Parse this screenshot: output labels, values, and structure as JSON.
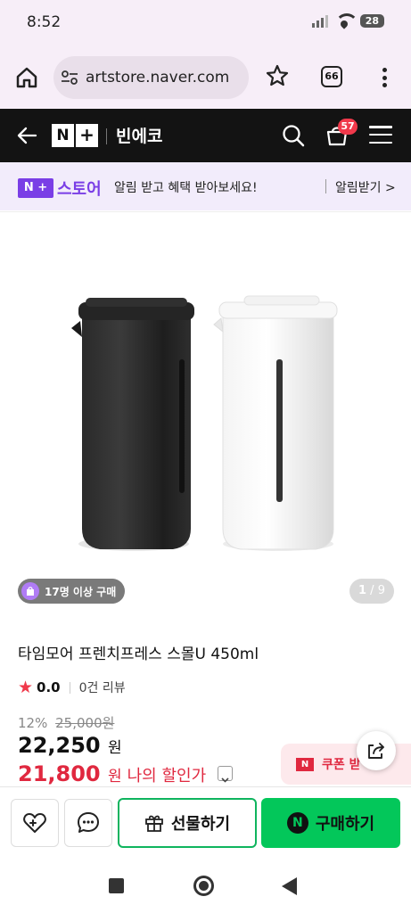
{
  "status_bar": {
    "time": "8:52",
    "battery": "28"
  },
  "browser": {
    "url": "artstore.naver.com",
    "tab_count": "66"
  },
  "store_header": {
    "logo_n": "N",
    "logo_plus": "+",
    "store_name": "빈에코",
    "cart_count": "57"
  },
  "notice": {
    "logo_box": "N +",
    "logo_text": "스토어",
    "message": "알림 받고 혜택 받아보세요!",
    "link": "알림받기 >"
  },
  "gallery": {
    "buyers_badge": "17명 이상 구매",
    "current_page": "1",
    "total_pages": "9"
  },
  "product": {
    "title": "타임모어 프렌치프레스 스몰U 450ml",
    "rating": "0.0",
    "reviews": "0건 리뷰",
    "discount_rate": "12%",
    "original_price": "25,000원",
    "sale_price": "22,250",
    "price_unit": "원",
    "my_price": "21,800",
    "my_price_label": "나의 할인가"
  },
  "coupon": {
    "badge": "N",
    "label": "쿠폰 받"
  },
  "actions": {
    "gift_label": "선물하기",
    "buy_label": "구매하기",
    "buy_icon_letter": "N"
  },
  "colors": {
    "naver_green": "#03c75a",
    "accent_purple": "#7a3ee6",
    "price_red": "#e0283f"
  },
  "icons": [
    "home-icon",
    "site-settings-icon",
    "bookmark-star-icon",
    "more-vert-icon",
    "back-arrow-icon",
    "search-icon",
    "cart-icon",
    "hamburger-icon",
    "shopping-bag-icon",
    "share-icon",
    "heart-plus-icon",
    "chat-icon",
    "gift-icon"
  ]
}
